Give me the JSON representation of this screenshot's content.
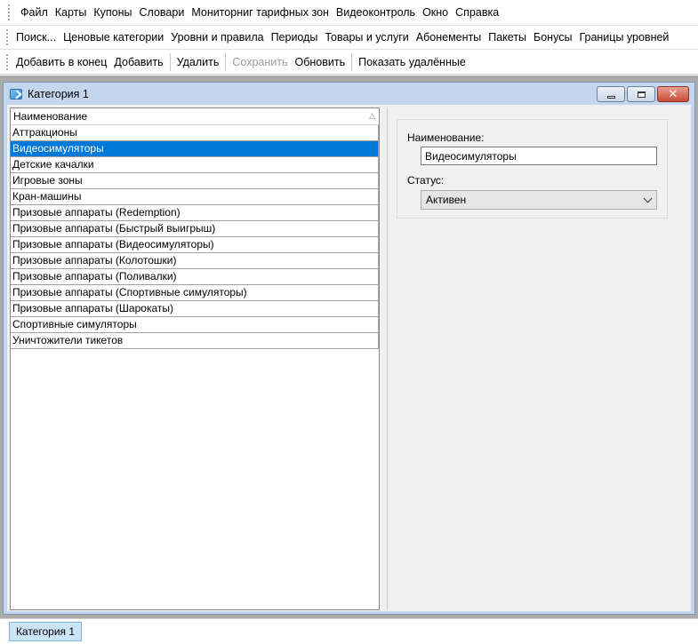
{
  "menubar": {
    "items": [
      "Файл",
      "Карты",
      "Купоны",
      "Словари",
      "Мониторниг тарифных зон",
      "Видеоконтроль",
      "Окно",
      "Справка"
    ]
  },
  "navbar": {
    "items": [
      "Поиск...",
      "Ценовые категории",
      "Уровни и правила",
      "Периоды",
      "Товары и услуги",
      "Абонементы",
      "Пакеты",
      "Бонусы",
      "Границы уровней"
    ]
  },
  "actionbar": {
    "add_end": "Добавить в конец",
    "add": "Добавить",
    "delete": "Удалить",
    "save": "Сохранить",
    "refresh": "Обновить",
    "show_deleted": "Показать удалённые"
  },
  "window": {
    "title": "Категория 1",
    "icon": "window-icon",
    "close_glyph": "✕"
  },
  "grid": {
    "header": "Наименование",
    "sort_glyph": "△",
    "selected_index": 1,
    "rows": [
      "Аттракционы",
      "Видеосимуляторы",
      "Детские качалки",
      "Игровые зоны",
      "Кран-машины",
      "Призовые аппараты (Redemption)",
      "Призовые аппараты (Быстрый выигрыш)",
      "Призовые аппараты (Видеосимуляторы)",
      "Призовые аппараты (Колотошки)",
      "Призовые аппараты (Поливалки)",
      "Призовые аппараты (Спортивные симуляторы)",
      "Призовые аппараты (Шарокаты)",
      "Спортивные симуляторы",
      "Уничтожители тикетов"
    ]
  },
  "detail": {
    "name_label": "Наименование:",
    "name_value": "Видеосимуляторы",
    "status_label": "Статус:",
    "status_value": "Активен"
  },
  "taskbar": {
    "tab_label": "Категория 1"
  },
  "colors": {
    "selection": "#0078d7",
    "title_bar": "#c4d6ed",
    "mdi_background": "#ababab"
  }
}
